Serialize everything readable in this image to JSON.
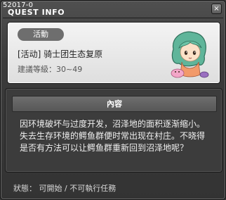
{
  "window": {
    "quest_id": "52017-0",
    "title": "QUEST INFO",
    "close_glyph": "×"
  },
  "header": {
    "tag": "活動",
    "quest_name": "[活动] 骑士团生态复原",
    "level": "建議等級：30~49"
  },
  "content": {
    "title": "內容",
    "text": "因环境破坏与过度开发，沼泽地的面积逐渐缩小。\n失去生存环境的鳄鱼群便时常出现在村庄。不晓得\n是否有方法可以让鳄鱼群重新回到沼泽地呢？"
  },
  "status": {
    "text": "狀態： 可開始 / 不可執行任務"
  },
  "colors": {
    "panel_dark": "#3c3c3c",
    "panel_light": "#ececec",
    "tag_bg": "#6e6e6e"
  },
  "icons": {
    "portrait": "npc-portrait-green-hair-girl",
    "close": "close-icon"
  }
}
